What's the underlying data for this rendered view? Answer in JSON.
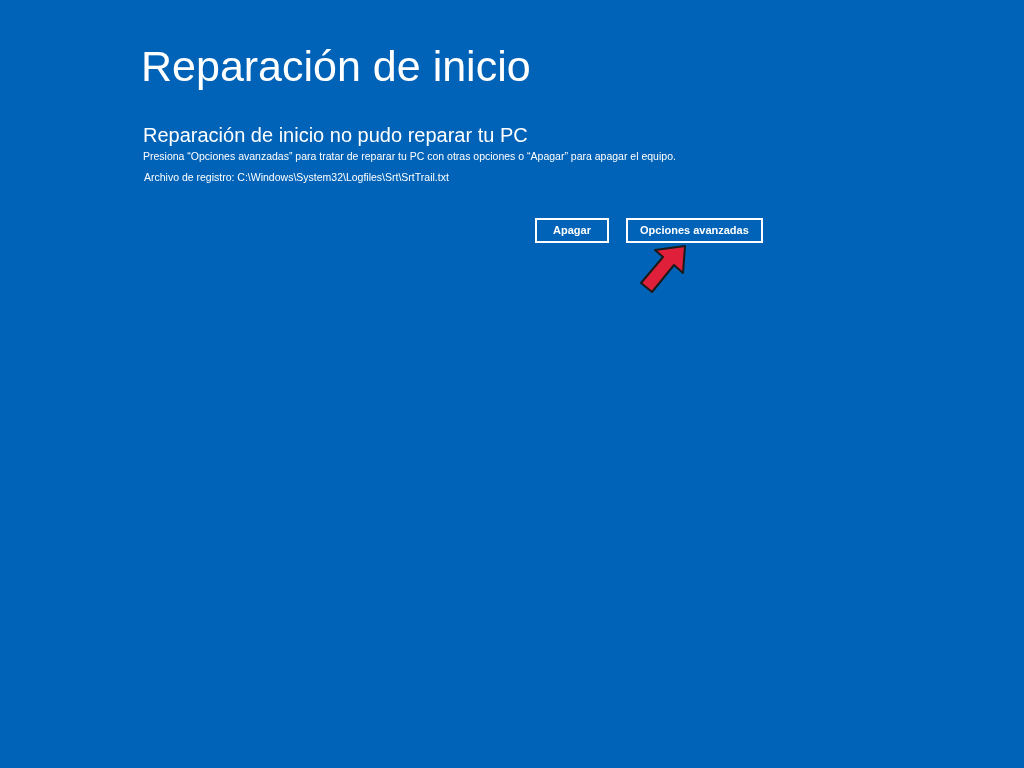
{
  "title": "Reparación de inicio",
  "heading": "Reparación de inicio no pudo reparar tu PC",
  "message": "Presiona “Opciones avanzadas” para tratar de reparar tu PC con otras opciones o “Apagar” para apagar el equipo.",
  "log_file": "Archivo de registro: C:\\Windows\\System32\\Logfiles\\Srt\\SrtTrail.txt",
  "buttons": [
    {
      "label": "Apagar"
    },
    {
      "label": "Opciones avanzadas"
    }
  ]
}
